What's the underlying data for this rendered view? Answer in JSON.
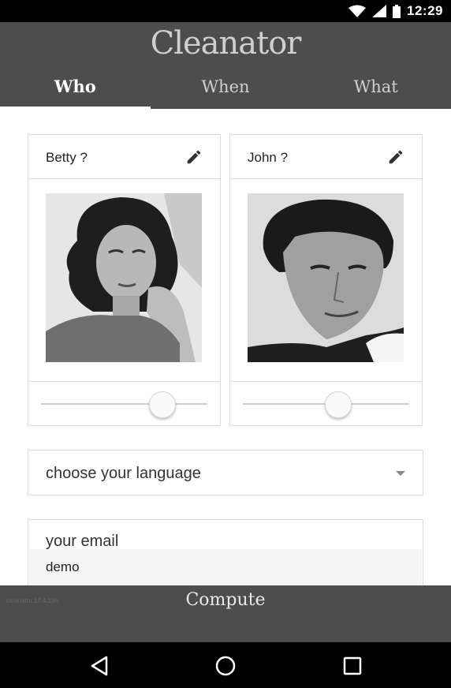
{
  "status_bar": {
    "time": "12:29",
    "icons": [
      "wifi-icon",
      "signal-icon",
      "battery-icon"
    ]
  },
  "app": {
    "title": "Cleanator"
  },
  "tabs": [
    {
      "label": "Who",
      "active": true
    },
    {
      "label": "When",
      "active": false
    },
    {
      "label": "What",
      "active": false
    }
  ],
  "people": [
    {
      "name": "Betty ?",
      "photo_icon": "portrait-woman",
      "slider_level": 0.74
    },
    {
      "name": "John ?",
      "photo_icon": "portrait-man",
      "slider_level": 0.58
    }
  ],
  "language": {
    "label": "choose your language"
  },
  "email": {
    "label": "your email",
    "value": "demo"
  },
  "footer": {
    "version": "cleanator.17.4.19h",
    "compute_label": "Compute"
  },
  "nav_bar": {
    "buttons": [
      "back-icon",
      "home-icon",
      "recents-icon"
    ]
  },
  "colors": {
    "header_bg": "#4d4d4d",
    "status_bg": "#000000",
    "card_border": "#dcdcdc"
  }
}
